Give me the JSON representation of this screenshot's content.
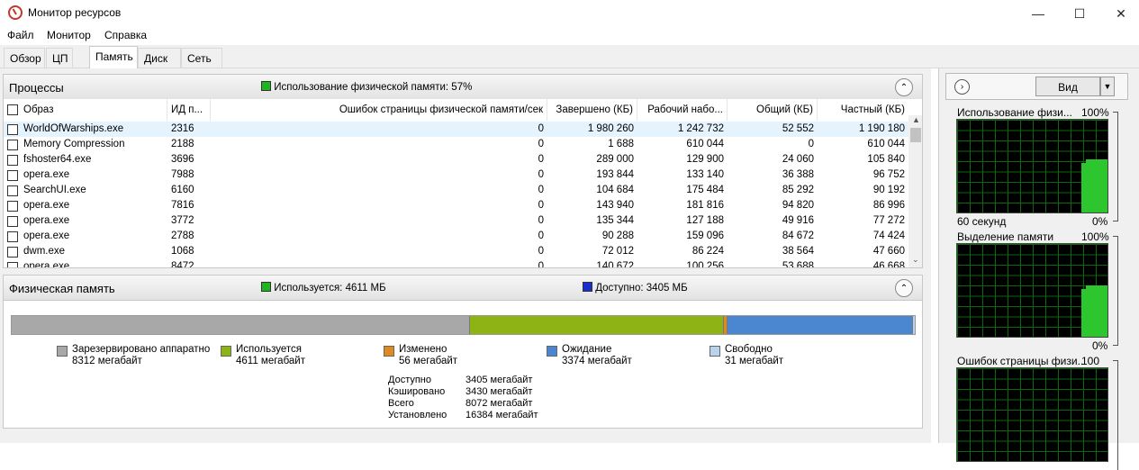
{
  "window": {
    "title": "Монитор ресурсов"
  },
  "menu": [
    "Файл",
    "Монитор",
    "Справка"
  ],
  "tabs": [
    "Обзор",
    "ЦП",
    "Память",
    "Диск",
    "Сеть"
  ],
  "processes": {
    "title": "Процессы",
    "usage_label": "Использование физической памяти: 57%",
    "columns": [
      "Образ",
      "ИД п...",
      "Ошибок страницы физической памяти/сек",
      "Завершено (КБ)",
      "Рабочий набо...",
      "Общий (КБ)",
      "Частный (КБ)"
    ],
    "rows": [
      [
        "WorldOfWarships.exe",
        "2316",
        "0",
        "1 980 260",
        "1 242 732",
        "52 552",
        "1 190 180"
      ],
      [
        "Memory Compression",
        "2188",
        "0",
        "1 688",
        "610 044",
        "0",
        "610 044"
      ],
      [
        "fshoster64.exe",
        "3696",
        "0",
        "289 000",
        "129 900",
        "24 060",
        "105 840"
      ],
      [
        "opera.exe",
        "7988",
        "0",
        "193 844",
        "133 140",
        "36 388",
        "96 752"
      ],
      [
        "SearchUI.exe",
        "6160",
        "0",
        "104 684",
        "175 484",
        "85 292",
        "90 192"
      ],
      [
        "opera.exe",
        "7816",
        "0",
        "143 940",
        "181 816",
        "94 820",
        "86 996"
      ],
      [
        "opera.exe",
        "3772",
        "0",
        "135 344",
        "127 188",
        "49 916",
        "77 272"
      ],
      [
        "opera.exe",
        "2788",
        "0",
        "90 288",
        "159 096",
        "84 672",
        "74 424"
      ],
      [
        "dwm.exe",
        "1068",
        "0",
        "72 012",
        "86 224",
        "38 564",
        "47 660"
      ],
      [
        "opera.exe",
        "8472",
        "0",
        "140 672",
        "100 256",
        "53 688",
        "46 668"
      ]
    ]
  },
  "physical": {
    "title": "Физическая память",
    "used_label": "Используется: 4611 МБ",
    "avail_label": "Доступно: 3405 МБ",
    "bar": [
      {
        "name": "reserved",
        "value": 8312,
        "color": "#a8a8a8"
      },
      {
        "name": "used",
        "value": 4611,
        "color": "#8db414"
      },
      {
        "name": "modified",
        "value": 56,
        "color": "#e08a1e"
      },
      {
        "name": "standby",
        "value": 3374,
        "color": "#4b86d0"
      },
      {
        "name": "free",
        "value": 31,
        "color": "#b9d3ee"
      }
    ],
    "legend": [
      {
        "name": "Зарезервировано аппаратно",
        "value": "8312 мегабайт",
        "color": "#a8a8a8"
      },
      {
        "name": "Используется",
        "value": "4611 мегабайт",
        "color": "#8db414"
      },
      {
        "name": "Изменено",
        "value": "56 мегабайт",
        "color": "#e08a1e"
      },
      {
        "name": "Ожидание",
        "value": "3374 мегабайт",
        "color": "#4b86d0"
      },
      {
        "name": "Свободно",
        "value": "31 мегабайт",
        "color": "#b9d3ee"
      }
    ],
    "summary": [
      {
        "label": "Доступно",
        "value": "3405 мегабайт"
      },
      {
        "label": "Кэшировано",
        "value": "3430 мегабайт"
      },
      {
        "label": "Всего",
        "value": "8072 мегабайт"
      },
      {
        "label": "Установлено",
        "value": "16384 мегабайт"
      }
    ]
  },
  "right": {
    "view_label": "Вид",
    "graphs": [
      {
        "title": "Использование физи...",
        "max": "100%",
        "footer_left": "60 секунд",
        "footer_right": "0%",
        "level": 0.57
      },
      {
        "title": "Выделение памяти",
        "max": "100%",
        "footer_left": "",
        "footer_right": "0%",
        "level": 0.55
      },
      {
        "title": "Ошибок страницы физи...",
        "max": "100",
        "footer_left": "",
        "footer_right": "",
        "level": 0
      }
    ]
  }
}
